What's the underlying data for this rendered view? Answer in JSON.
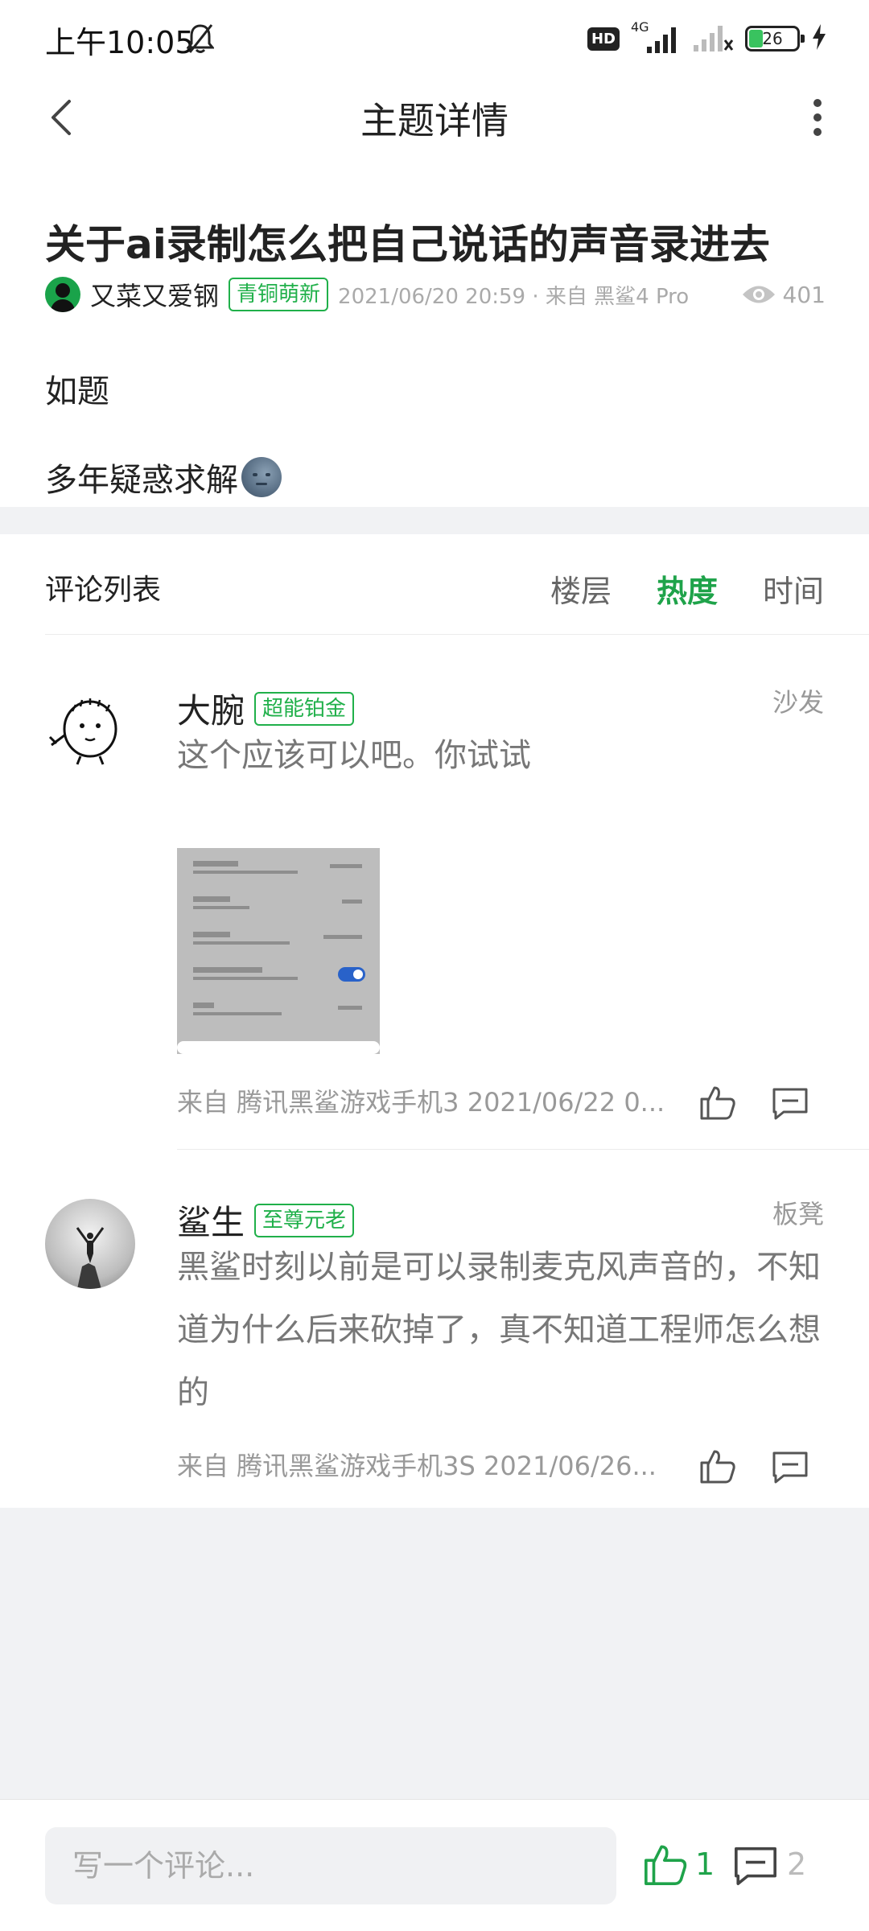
{
  "status_bar": {
    "time": "上午10:05",
    "hd_badge": "HD",
    "network": "4G",
    "battery": "26"
  },
  "header": {
    "title": "主题详情"
  },
  "post": {
    "title": "关于ai录制怎么把自己说话的声音录进去",
    "author": "又菜又爱钢",
    "author_badge": "青铜萌新",
    "time_source": "2021/06/20 20:59 · 来自 黑鲨4 Pro",
    "views": "401",
    "body": [
      "如题",
      "多年疑惑求解"
    ]
  },
  "comments_section": {
    "title": "评论列表",
    "sort_options": [
      "楼层",
      "热度",
      "时间"
    ],
    "active_sort": "热度",
    "items": [
      {
        "name": "大腕",
        "badge": "超能铂金",
        "floor": "沙发",
        "text": "这个应该可以吧。你试试",
        "source": "来自 腾讯黑鲨游戏手机3  2021/06/22 0..."
      },
      {
        "name": "鲨生",
        "badge": "至尊元老",
        "floor": "板凳",
        "text": "黑鲨时刻以前是可以录制麦克风声音的，不知道为什么后来砍掉了，真不知道工程师怎么想的",
        "source": "来自 腾讯黑鲨游戏手机3S  2021/06/26..."
      }
    ]
  },
  "bottom_bar": {
    "input_placeholder": "写一个评论...",
    "like_count": "1",
    "comment_count": "2"
  },
  "colors": {
    "accent": "#1fa34a",
    "badge_border": "#20b04a",
    "secondary_text": "#999999"
  },
  "icons": [
    "bell-off-icon",
    "signal-icon",
    "battery-icon",
    "charging-icon",
    "back-arrow-icon",
    "more-vertical-icon",
    "eye-icon",
    "thumbs-up-icon",
    "comment-icon"
  ]
}
